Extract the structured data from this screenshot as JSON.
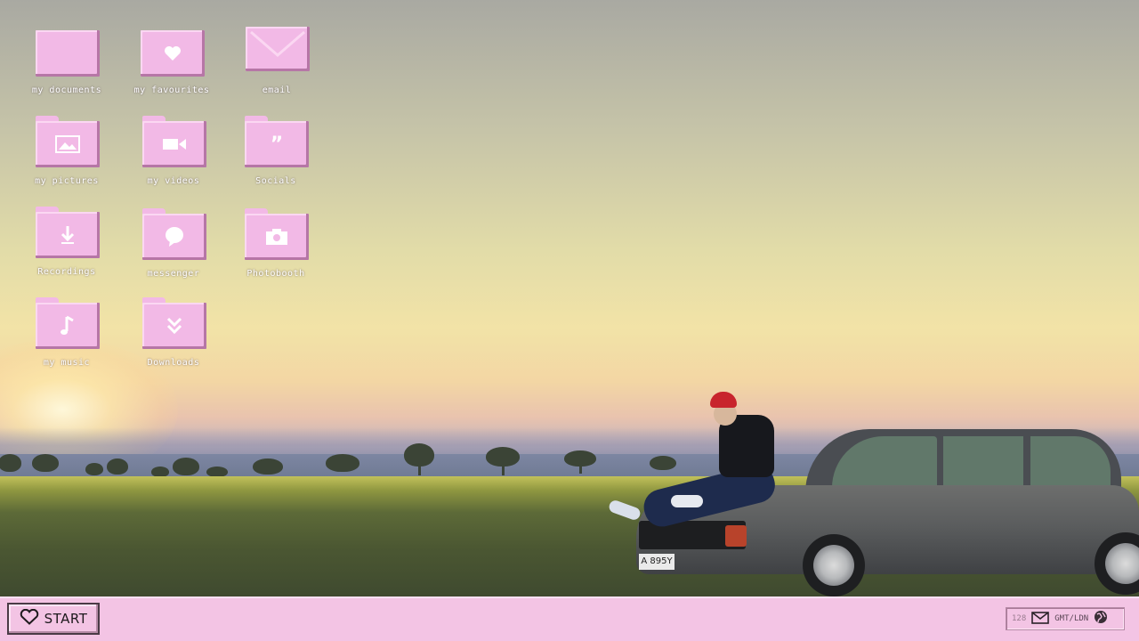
{
  "desktop": {
    "icons": [
      {
        "label": "my documents",
        "icon": "folder-icon"
      },
      {
        "label": "my favourites",
        "icon": "heart-folder-icon"
      },
      {
        "label": "email",
        "icon": "envelope-icon"
      },
      {
        "label": "my pictures",
        "icon": "picture-folder-icon"
      },
      {
        "label": "my videos",
        "icon": "video-camera-folder-icon"
      },
      {
        "label": "Socials",
        "icon": "quote-folder-icon"
      },
      {
        "label": "Recordings",
        "icon": "download-arrow-folder-icon"
      },
      {
        "label": "messenger",
        "icon": "speech-bubble-folder-icon"
      },
      {
        "label": "Photobooth",
        "icon": "camera-folder-icon"
      },
      {
        "label": "my music",
        "icon": "music-note-folder-icon"
      },
      {
        "label": "Downloads",
        "icon": "double-chevron-down-folder-icon"
      }
    ]
  },
  "wallpaper": {
    "description_icon": "sunset-field-car-wallpaper",
    "plate": "A 895Y"
  },
  "taskbar": {
    "start_label": "START",
    "start_icon": "heart-icon",
    "tray": {
      "count": "128",
      "mail_icon": "envelope-icon",
      "clock": "GMT/LDN",
      "globe_icon": "globe-icon"
    }
  },
  "colors": {
    "taskbar": "#f3c4e4",
    "folder": "#f2b9e6",
    "folder_shadow": "#b676a6",
    "label": "#ffffff"
  }
}
